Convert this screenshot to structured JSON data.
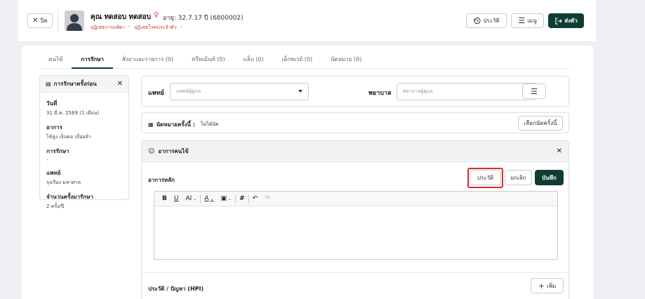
{
  "header": {
    "close_label": "ปิด",
    "patient_name": "คุณ ทดสอบ ทดสอบ",
    "age_text": "อายุ: 32.7.17 ปี",
    "hn": "(6800002)",
    "allergy_drug": "ปฏิเสธการแพ้ยา",
    "allergy_disease": "ปฏิเสธโรคประจำตัว",
    "history_label": "ประวัติ",
    "menu_label": "เมนู",
    "send_label": "ส่งตัว"
  },
  "tabs": [
    {
      "label": "คนไข้",
      "active": false
    },
    {
      "label": "การรักษา",
      "active": true
    },
    {
      "label": "สั่งยาและรายการ (0)",
      "active": false
    },
    {
      "label": "ทรีทเม้นท์ (0)",
      "active": false
    },
    {
      "label": "แล็บ (0)",
      "active": false
    },
    {
      "label": "เอ็กซเรย์ (0)",
      "active": false
    },
    {
      "label": "นัดหมาย (0)",
      "active": false
    }
  ],
  "previous_treatment": {
    "title": "การรักษาครั้งก่อน",
    "fields": [
      {
        "label": "วันที่",
        "value": "31 มี.ค. 2569 (1 เดือน)"
      },
      {
        "label": "อาการ",
        "value": "ไข้สูง เจ็บคอ เมื่อยล้า"
      },
      {
        "label": "การรักษา",
        "value": "-"
      },
      {
        "label": "แพทย์",
        "value": "รุ่งเรือง มหาศาล"
      },
      {
        "label": "จำนวนครั้งมารักษา",
        "value": "2 ครั้ง/ปี"
      }
    ]
  },
  "staff": {
    "doctor_label": "แพทย์",
    "doctor_placeholder": "แพทย์ผู้ดูแล",
    "nurse_label": "พยาบาล",
    "nurse_placeholder": "พยาบาลผู้ดูแล"
  },
  "appointment": {
    "label": "นัดหมายครั้งนี้ :",
    "value": "ไม่ได้นัด",
    "select_button": "เลือกนัดครั้งนี้"
  },
  "symptoms": {
    "title": "อาการคนไข้",
    "main_label": "อาการหลัก",
    "history_button": "ประวัติ",
    "cancel_button": "ยกเลิก",
    "save_button": "บันทึก",
    "hpi_label": "ประวัติ / ปัญหา (HPI)",
    "add_button": "เพิ่ม"
  },
  "toolbar_icons": [
    "bold-icon",
    "underline-icon",
    "text-size-icon",
    "font-color-icon",
    "highlight-icon",
    "hashtag-icon",
    "undo-icon",
    "redo-icon"
  ]
}
